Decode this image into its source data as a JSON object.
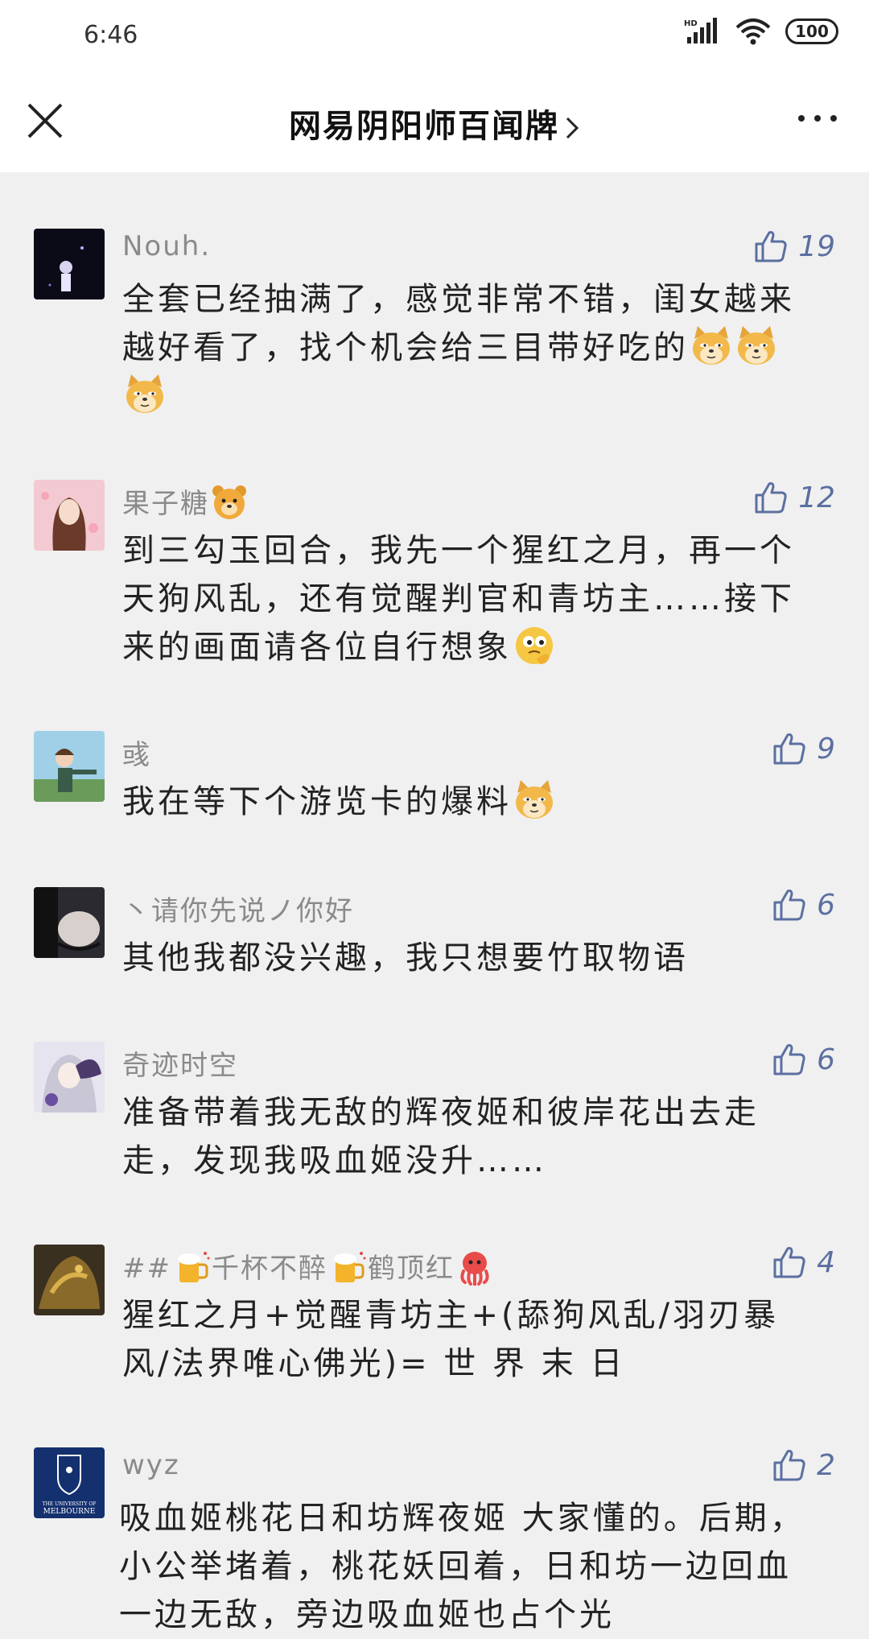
{
  "status_bar": {
    "time": "6:46",
    "battery": "100"
  },
  "nav": {
    "title": "网易阴阳师百闻牌"
  },
  "comments": [
    {
      "user": "Nouh.",
      "likes": "19",
      "text": "全套已经抽满了，感觉非常不错，闺女越来越好看了，找个机会给三目带好吃的"
    },
    {
      "user": "果子糖",
      "likes": "12",
      "text": "到三勾玉回合，我先一个猩红之月，再一个天狗风乱，还有觉醒判官和青坊主……接下来的画面请各位自行想象"
    },
    {
      "user": "彧",
      "likes": "9",
      "text": "我在等下个游览卡的爆料"
    },
    {
      "user": "丶请你先说ノ你好",
      "likes": "6",
      "text": "其他我都没兴趣，我只想要竹取物语"
    },
    {
      "user": "奇迹时空",
      "likes": "6",
      "text": "准备带着我无敌的辉夜姬和彼岸花出去走走，发现我吸血姬没升……"
    },
    {
      "user_parts": [
        "##",
        "千杯不醉",
        "鹤顶红"
      ],
      "likes": "4",
      "text": "猩红之月+觉醒青坊主+(舔狗风乱/羽刃暴风/法界唯心佛光)= 世  界  末  日"
    },
    {
      "user": "wyz",
      "likes": "2",
      "text": "吸血姬桃花日和坊辉夜姬 大家懂的。后期，小公举堵着，桃花妖回着，日和坊一边回血一边无敌，旁边吸血姬也占个光"
    }
  ],
  "avatar_text": {
    "melbourne_line1": "THE UNIVERSITY OF",
    "melbourne_line2": "MELBOURNE"
  },
  "colors": {
    "like": "#5b6fa0",
    "username": "#8a8a8a",
    "background": "#f0f0f0"
  }
}
